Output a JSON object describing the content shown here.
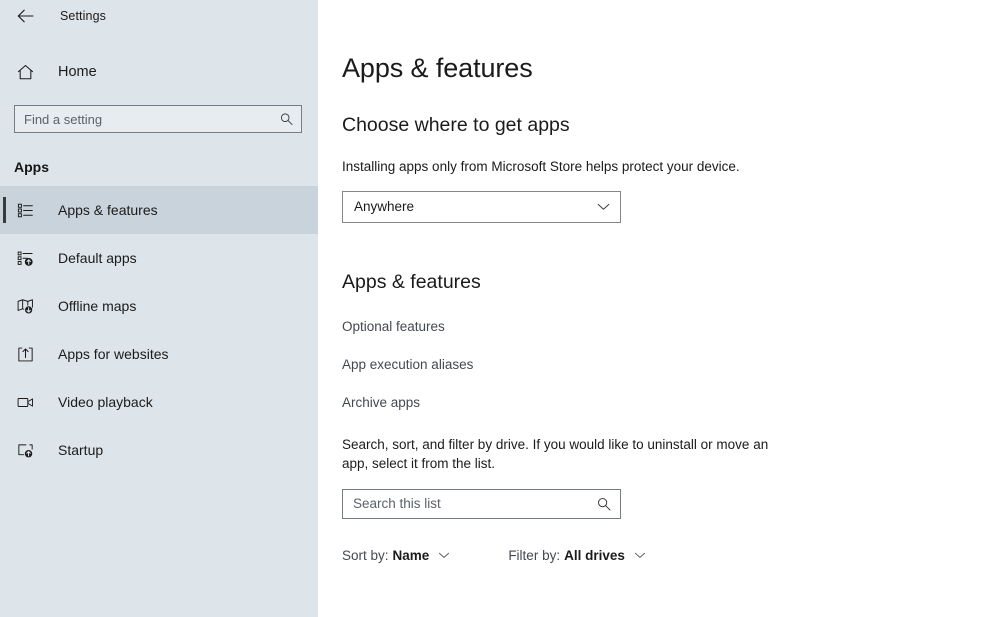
{
  "window": {
    "back_label": "Back",
    "back_icon": "arrow-left-icon",
    "title": "Settings"
  },
  "sidebar": {
    "home": {
      "label": "Home",
      "icon": "home-icon"
    },
    "search": {
      "placeholder": "Find a setting",
      "value": "",
      "icon": "search-icon"
    },
    "section_label": "Apps",
    "items": [
      {
        "label": "Apps & features",
        "icon": "list-bullets-icon",
        "selected": true
      },
      {
        "label": "Default apps",
        "icon": "default-apps-icon",
        "selected": false
      },
      {
        "label": "Offline maps",
        "icon": "map-download-icon",
        "selected": false
      },
      {
        "label": "Apps for websites",
        "icon": "app-website-icon",
        "selected": false
      },
      {
        "label": "Video playback",
        "icon": "video-camera-icon",
        "selected": false
      },
      {
        "label": "Startup",
        "icon": "startup-icon",
        "selected": false
      }
    ]
  },
  "main": {
    "page_title": "Apps & features",
    "choose_section": {
      "heading": "Choose where to get apps",
      "description": "Installing apps only from Microsoft Store helps protect your device.",
      "dropdown": {
        "value": "Anywhere",
        "chevron_icon": "chevron-down-icon"
      }
    },
    "apps_section": {
      "heading": "Apps & features",
      "links": [
        "Optional features",
        "App execution aliases",
        "Archive apps"
      ],
      "description": "Search, sort, and filter by drive. If you would like to uninstall or move an app, select it from the list.",
      "search": {
        "placeholder": "Search this list",
        "value": "",
        "icon": "search-icon"
      },
      "controls": [
        {
          "label": "Sort by:",
          "value": "Name",
          "chevron_icon": "chevron-down-icon"
        },
        {
          "label": "Filter by:",
          "value": "All drives",
          "chevron_icon": "chevron-down-icon"
        }
      ]
    }
  },
  "colors": {
    "sidebar_bg": "#dde5eb",
    "sidebar_selected_bg": "#c9d3db",
    "accent_bar": "#3a3a3a",
    "text_primary": "#1b1b1b",
    "text_secondary": "#44494e",
    "main_bg": "#ffffff"
  }
}
